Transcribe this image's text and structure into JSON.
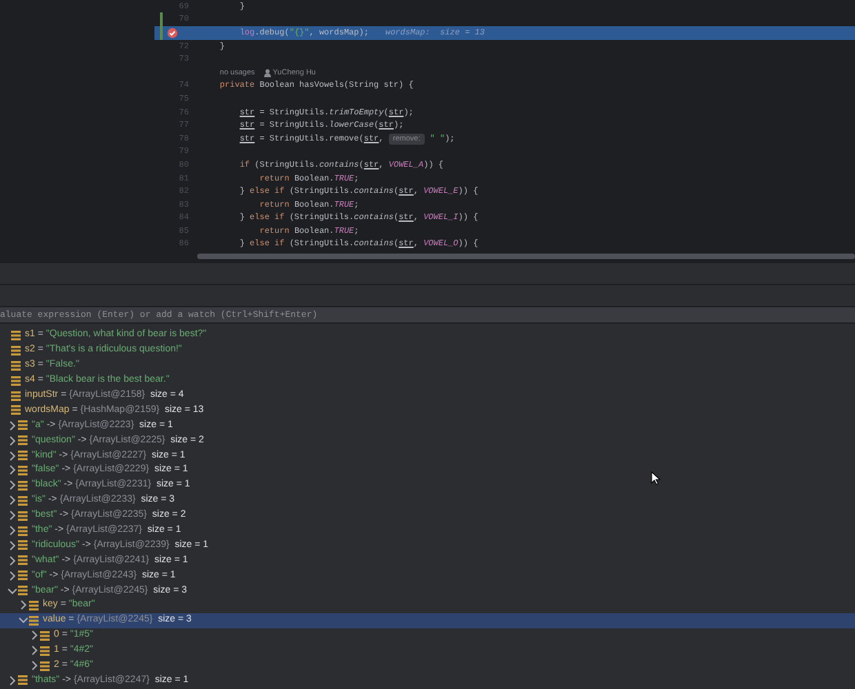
{
  "editor": {
    "lines": [
      {
        "kind": "code",
        "number": "69",
        "tokens": [
          {
            "t": "        }",
            "kind": "plain"
          }
        ]
      },
      {
        "kind": "code",
        "number": "70",
        "changed": true
      },
      {
        "kind": "code",
        "changed": true,
        "breakpoint": true,
        "current": true,
        "tokens": [
          {
            "t": "        log",
            "kind": "field"
          },
          {
            "t": ".debug(",
            "kind": "plain"
          },
          {
            "t": "\"{}\"",
            "kind": "str"
          },
          {
            "t": ", wordsMap);",
            "kind": "plain"
          },
          {
            "t": "wordsMap:  size = 13",
            "kind": "inline"
          }
        ]
      },
      {
        "kind": "code",
        "number": "72",
        "tokens": [
          {
            "t": "    }",
            "kind": "plain"
          }
        ]
      },
      {
        "kind": "code",
        "number": "73"
      },
      {
        "kind": "annotation",
        "usages": "no usages",
        "author": "YuCheng Hu"
      },
      {
        "kind": "code",
        "number": "74",
        "tokens": [
          {
            "t": "    private ",
            "kind": "kw"
          },
          {
            "t": "Boolean hasVowels(String str) {",
            "kind": "plain"
          }
        ]
      },
      {
        "kind": "code",
        "number": "75"
      },
      {
        "kind": "code",
        "number": "76",
        "tokens": [
          {
            "t": "        str",
            "kind": "param"
          },
          {
            "t": " = StringUtils.",
            "kind": "plain"
          },
          {
            "t": "trimToEmpty",
            "kind": "static"
          },
          {
            "t": "(",
            "kind": "plain"
          },
          {
            "t": "str",
            "kind": "param"
          },
          {
            "t": ");",
            "kind": "plain"
          }
        ]
      },
      {
        "kind": "code",
        "number": "77",
        "tokens": [
          {
            "t": "        str",
            "kind": "param"
          },
          {
            "t": " = StringUtils.",
            "kind": "plain"
          },
          {
            "t": "lowerCase",
            "kind": "static"
          },
          {
            "t": "(",
            "kind": "plain"
          },
          {
            "t": "str",
            "kind": "param"
          },
          {
            "t": ");",
            "kind": "plain"
          }
        ]
      },
      {
        "kind": "code",
        "number": "78",
        "tokens": [
          {
            "t": "        str",
            "kind": "param"
          },
          {
            "t": " = StringUtils.remove(",
            "kind": "plain"
          },
          {
            "t": "str",
            "kind": "param"
          },
          {
            "t": ", ",
            "kind": "plain"
          },
          {
            "t": "remove:",
            "kind": "hint"
          },
          {
            "t": "\" \"",
            "kind": "str"
          },
          {
            "t": ");",
            "kind": "plain"
          }
        ]
      },
      {
        "kind": "code",
        "number": "79"
      },
      {
        "kind": "code",
        "number": "80",
        "tokens": [
          {
            "t": "        if ",
            "kind": "kw"
          },
          {
            "t": "(StringUtils.",
            "kind": "plain"
          },
          {
            "t": "contains",
            "kind": "static"
          },
          {
            "t": "(",
            "kind": "plain"
          },
          {
            "t": "str",
            "kind": "param"
          },
          {
            "t": ", ",
            "kind": "plain"
          },
          {
            "t": "VOWEL_A",
            "kind": "const"
          },
          {
            "t": ")) {",
            "kind": "plain"
          }
        ]
      },
      {
        "kind": "code",
        "number": "81",
        "tokens": [
          {
            "t": "            return ",
            "kind": "kw"
          },
          {
            "t": "Boolean.",
            "kind": "plain"
          },
          {
            "t": "TRUE",
            "kind": "const"
          },
          {
            "t": ";",
            "kind": "plain"
          }
        ]
      },
      {
        "kind": "code",
        "number": "82",
        "tokens": [
          {
            "t": "        } ",
            "kind": "plain"
          },
          {
            "t": "else if ",
            "kind": "kw"
          },
          {
            "t": "(StringUtils.",
            "kind": "plain"
          },
          {
            "t": "contains",
            "kind": "static"
          },
          {
            "t": "(",
            "kind": "plain"
          },
          {
            "t": "str",
            "kind": "param"
          },
          {
            "t": ", ",
            "kind": "plain"
          },
          {
            "t": "VOWEL_E",
            "kind": "const"
          },
          {
            "t": ")) {",
            "kind": "plain"
          }
        ]
      },
      {
        "kind": "code",
        "number": "83",
        "tokens": [
          {
            "t": "            return ",
            "kind": "kw"
          },
          {
            "t": "Boolean.",
            "kind": "plain"
          },
          {
            "t": "TRUE",
            "kind": "const"
          },
          {
            "t": ";",
            "kind": "plain"
          }
        ]
      },
      {
        "kind": "code",
        "number": "84",
        "tokens": [
          {
            "t": "        } ",
            "kind": "plain"
          },
          {
            "t": "else if ",
            "kind": "kw"
          },
          {
            "t": "(StringUtils.",
            "kind": "plain"
          },
          {
            "t": "contains",
            "kind": "static"
          },
          {
            "t": "(",
            "kind": "plain"
          },
          {
            "t": "str",
            "kind": "param"
          },
          {
            "t": ", ",
            "kind": "plain"
          },
          {
            "t": "VOWEL_I",
            "kind": "const"
          },
          {
            "t": ")) {",
            "kind": "plain"
          }
        ]
      },
      {
        "kind": "code",
        "number": "85",
        "tokens": [
          {
            "t": "            return ",
            "kind": "kw"
          },
          {
            "t": "Boolean.",
            "kind": "plain"
          },
          {
            "t": "TRUE",
            "kind": "const"
          },
          {
            "t": ";",
            "kind": "plain"
          }
        ]
      },
      {
        "kind": "code",
        "number": "86",
        "tokens": [
          {
            "t": "        } ",
            "kind": "plain"
          },
          {
            "t": "else if ",
            "kind": "kw"
          },
          {
            "t": "(StringUtils.",
            "kind": "plain"
          },
          {
            "t": "contains",
            "kind": "static"
          },
          {
            "t": "(",
            "kind": "plain"
          },
          {
            "t": "str",
            "kind": "param"
          },
          {
            "t": ", ",
            "kind": "plain"
          },
          {
            "t": "VOWEL_O",
            "kind": "const"
          },
          {
            "t": ")) {",
            "kind": "plain"
          }
        ]
      }
    ]
  },
  "evaluate": {
    "placeholder": "aluate expression (Enter) or add a watch (Ctrl+Shift+Enter)"
  },
  "variables": [
    {
      "kind": "field",
      "name": "s1",
      "op": "=",
      "value": {
        "t": "\"Question, what kind of bear is best?\"",
        "kind": "string"
      }
    },
    {
      "kind": "field",
      "name": "s2",
      "op": "=",
      "value": {
        "t": "\"That's is a ridiculous question!\"",
        "kind": "string"
      }
    },
    {
      "kind": "field",
      "name": "s3",
      "op": "=",
      "value": {
        "t": "\"False.\"",
        "kind": "string"
      }
    },
    {
      "kind": "field",
      "name": "s4",
      "op": "=",
      "value": {
        "t": "\"Black bear is the best bear.\"",
        "kind": "string"
      }
    },
    {
      "kind": "field",
      "name": "inputStr",
      "op": "=",
      "value": {
        "t": "{ArrayList@2158}",
        "kind": "object"
      },
      "size": "size = 4"
    },
    {
      "kind": "field",
      "name": "wordsMap",
      "op": "=",
      "value": {
        "t": "{HashMap@2159}",
        "kind": "object"
      },
      "size": "size = 13",
      "children": [
        {
          "kind": "entry",
          "name": "\"a\"",
          "op": "->",
          "value": {
            "t": "{ArrayList@2223}",
            "kind": "object"
          },
          "size": "size = 1",
          "expanded": false
        },
        {
          "kind": "entry",
          "name": "\"question\"",
          "op": "->",
          "value": {
            "t": "{ArrayList@2225}",
            "kind": "object"
          },
          "size": "size = 2",
          "expanded": false
        },
        {
          "kind": "entry",
          "name": "\"kind\"",
          "op": "->",
          "value": {
            "t": "{ArrayList@2227}",
            "kind": "object"
          },
          "size": "size = 1",
          "expanded": false
        },
        {
          "kind": "entry",
          "name": "\"false\"",
          "op": "->",
          "value": {
            "t": "{ArrayList@2229}",
            "kind": "object"
          },
          "size": "size = 1",
          "expanded": false
        },
        {
          "kind": "entry",
          "name": "\"black\"",
          "op": "->",
          "value": {
            "t": "{ArrayList@2231}",
            "kind": "object"
          },
          "size": "size = 1",
          "expanded": false
        },
        {
          "kind": "entry",
          "name": "\"is\"",
          "op": "->",
          "value": {
            "t": "{ArrayList@2233}",
            "kind": "object"
          },
          "size": "size = 3",
          "expanded": false
        },
        {
          "kind": "entry",
          "name": "\"best\"",
          "op": "->",
          "value": {
            "t": "{ArrayList@2235}",
            "kind": "object"
          },
          "size": "size = 2",
          "expanded": false
        },
        {
          "kind": "entry",
          "name": "\"the\"",
          "op": "->",
          "value": {
            "t": "{ArrayList@2237}",
            "kind": "object"
          },
          "size": "size = 1",
          "expanded": false
        },
        {
          "kind": "entry",
          "name": "\"ridiculous\"",
          "op": "->",
          "value": {
            "t": "{ArrayList@2239}",
            "kind": "object"
          },
          "size": "size = 1",
          "expanded": false
        },
        {
          "kind": "entry",
          "name": "\"what\"",
          "op": "->",
          "value": {
            "t": "{ArrayList@2241}",
            "kind": "object"
          },
          "size": "size = 1",
          "expanded": false
        },
        {
          "kind": "entry",
          "name": "\"of\"",
          "op": "->",
          "value": {
            "t": "{ArrayList@2243}",
            "kind": "object"
          },
          "size": "size = 1",
          "expanded": false
        },
        {
          "kind": "entry",
          "name": "\"bear\"",
          "op": "->",
          "value": {
            "t": "{ArrayList@2245}",
            "kind": "object"
          },
          "size": "size = 3",
          "expanded": true,
          "children": [
            {
              "kind": "field",
              "name": "key",
              "op": "=",
              "value": {
                "t": "\"bear\"",
                "kind": "string"
              },
              "expanded": false
            },
            {
              "kind": "field",
              "name": "value",
              "op": "=",
              "value": {
                "t": "{ArrayList@2245}",
                "kind": "object"
              },
              "size": "size = 3",
              "expanded": true,
              "selected": true,
              "children": [
                {
                  "kind": "field",
                  "name": "0",
                  "op": "=",
                  "value": {
                    "t": "\"1#5\"",
                    "kind": "string"
                  },
                  "expanded": false
                },
                {
                  "kind": "field",
                  "name": "1",
                  "op": "=",
                  "value": {
                    "t": "\"4#2\"",
                    "kind": "string"
                  },
                  "expanded": false
                },
                {
                  "kind": "field",
                  "name": "2",
                  "op": "=",
                  "value": {
                    "t": "\"4#6\"",
                    "kind": "string"
                  },
                  "expanded": false
                }
              ]
            }
          ]
        },
        {
          "kind": "entry",
          "name": "\"thats\"",
          "op": "->",
          "value": {
            "t": "{ArrayList@2247}",
            "kind": "object"
          },
          "size": "size = 1",
          "expanded": false
        }
      ]
    }
  ]
}
